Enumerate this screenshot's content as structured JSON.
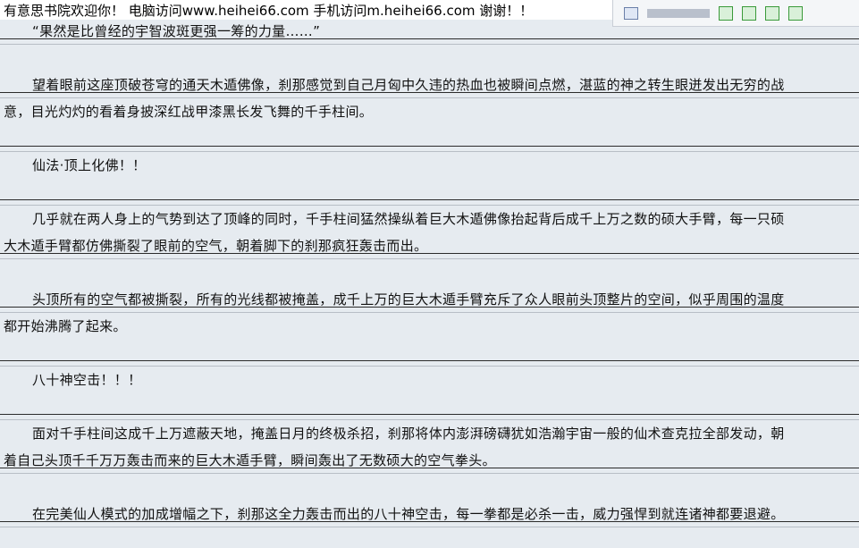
{
  "banner": {
    "text": "有意思书院欢迎你！ 电脑访问www.heihei66.com   手机访问m.heihei66.com 谢谢！！"
  },
  "paragraphs": {
    "l1": "“果然是比曾经的宇智波斑更强一筹的力量……”",
    "l2": "望着眼前这座顶破苍穹的通天木遁佛像，刹那感觉到自己月匈中久违的热血也被瞬间点燃，湛蓝的神之转生眼迸发出无穷的战",
    "l3": "意，目光灼灼的看着身披深红战甲漆黑长发飞舞的千手柱间。",
    "l4": "仙法·顶上化佛！！",
    "l5": "几乎就在两人身上的气势到达了顶峰的同时，千手柱间猛然操纵着巨大木遁佛像抬起背后成千上万之数的硕大手臂，每一只硕",
    "l6": "大木遁手臂都仿佛撕裂了眼前的空气，朝着脚下的刹那疯狂轰击而出。",
    "l7": "头顶所有的空气都被撕裂，所有的光线都被掩盖，成千上万的巨大木遁手臂充斥了众人眼前头顶整片的空间，似乎周围的温度",
    "l8": "都开始沸腾了起来。",
    "l9": "八十神空击！！！",
    "l10": "面对千手柱间这成千上万遮蔽天地，掩盖日月的终极杀招，刹那将体内澎湃磅礴犹如浩瀚宇宙一般的仙术查克拉全部发动，朝",
    "l11": "着自己头顶千千万万轰击而来的巨大木遁手臂，瞬间轰出了无数硕大的空气拳头。",
    "l12": "在完美仙人模式的加成增幅之下，刹那这全力轰击而出的八十神空击，每一拳都是必杀一击，威力强悍到就连诸神都要退避。"
  }
}
